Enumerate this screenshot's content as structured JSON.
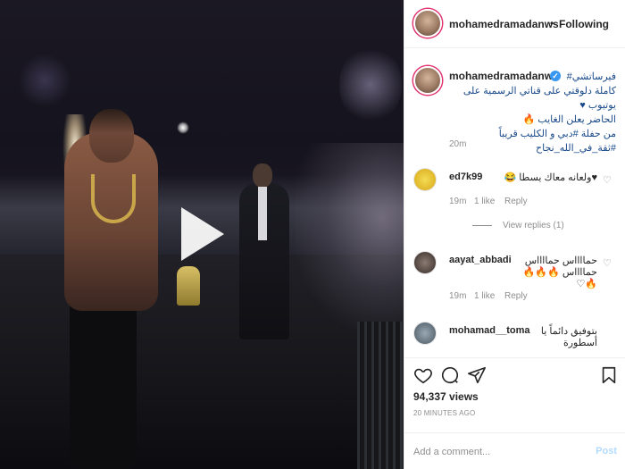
{
  "post": {
    "username": "mohamedramadanws",
    "separator": "•",
    "follow_label": "Following",
    "verified_icon": "✓",
    "caption_lines": [
      "فيرساتشي#",
      "كاملة دلوقتي على قناتي الرسمية على يوتيوب ♥",
      "الحاضر يعلن الغايب 🔥",
      "من حفلة #دبي و الكليب قريباً #ثقة_في_الله_نجاح"
    ],
    "caption_time": "20m"
  },
  "comments": [
    {
      "username": "ed7k99",
      "text": "♥ولعانه معاك يسطا 😂",
      "time": "19m",
      "likes": "1 like",
      "reply": "Reply",
      "view_replies": "View replies (1)",
      "avatar_color": "#e8c93a"
    },
    {
      "username": "aayat_abbadi",
      "text": "حمااااس حمااااس حمااااس 🔥🔥🔥🔥♡",
      "time": "19m",
      "likes": "1 like",
      "reply": "Reply",
      "avatar_color": "#6a5a55"
    },
    {
      "username": "mohamad__toma",
      "text": "بتوفيق دائماً يا أسطورة",
      "avatar_color": "#6b7a86"
    }
  ],
  "stats": {
    "views": "94,337 views",
    "time_ago": "20 MINUTES AGO"
  },
  "comment_box": {
    "placeholder": "Add a comment...",
    "post_label": "Post"
  },
  "icons": {
    "like": "heart-icon",
    "comment": "comment-icon",
    "share": "share-icon",
    "save": "bookmark-icon",
    "play": "play-icon"
  },
  "colors": {
    "link_blue": "#3897f0",
    "story_ring": "#e1306c",
    "meta_gray": "#8e8e8e"
  }
}
